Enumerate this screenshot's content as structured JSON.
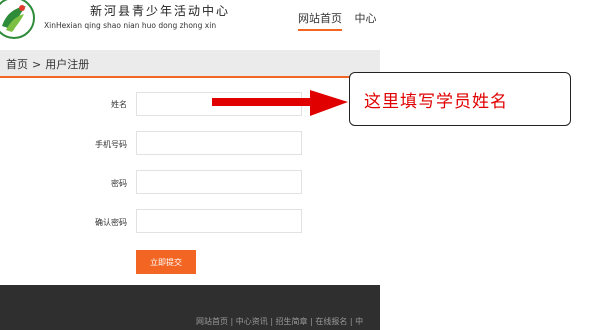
{
  "header": {
    "title": "新河县青少年活动中心",
    "subtitle": "XinHexian qing shao nian huo dong zhong xin",
    "nav": [
      "网站首页",
      "中心"
    ]
  },
  "breadcrumb": {
    "home": "首页",
    "separator": ">",
    "current": "用户注册"
  },
  "form": {
    "name_label": "姓名",
    "phone_label": "手机号码",
    "password_label": "密码",
    "confirm_label": "确认密码",
    "submit_label": "立即提交"
  },
  "footer": {
    "links": "网站首页 | 中心资讯 | 招生简章 | 在线报名 | 中"
  },
  "annotation": {
    "text": "这里填写学员姓名"
  },
  "colors": {
    "accent": "#f26522",
    "annotation_red": "#e00000",
    "footer_bg": "#2f2f2f"
  }
}
